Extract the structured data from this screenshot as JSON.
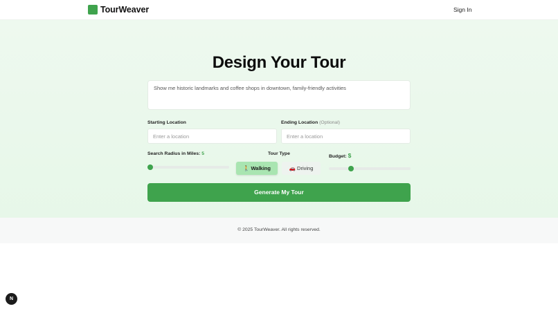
{
  "header": {
    "brand": "TourWeaver",
    "sign_in": "Sign In"
  },
  "hero": {
    "title": "Design Your Tour",
    "prompt_text": "Show me historic landmarks and coffee shops in downtown, family-friendly activities"
  },
  "form": {
    "start_label": "Starting Location",
    "start_placeholder": "Enter a location",
    "end_label": "Ending Location",
    "end_optional": "(Optional)",
    "end_placeholder": "Enter a location",
    "radius_label": "Search Radius in Miles:",
    "radius_value": "5",
    "radius_fraction": 0.0,
    "tour_type_label": "Tour Type",
    "tour_types": [
      {
        "icon": "walking-icon",
        "label": "Walking",
        "active": true
      },
      {
        "icon": "car-icon",
        "label": "Driving",
        "active": false
      }
    ],
    "budget_label": "Budget:",
    "budget_value": "$",
    "budget_fraction": 0.25,
    "generate_label": "Generate My Tour"
  },
  "footer": {
    "copyright": "© 2025 TourWeaver. All rights reserved."
  },
  "badge": {
    "letter": "N"
  },
  "colors": {
    "accent": "#3fa34d",
    "active_tab": "#a9e5b1",
    "hero_bg": "#e6f7e8"
  }
}
